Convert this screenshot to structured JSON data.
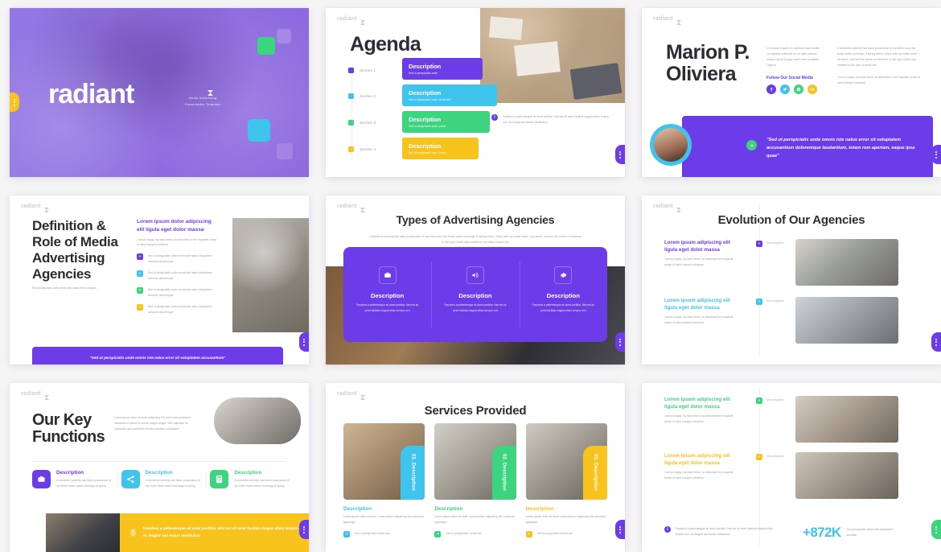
{
  "palette": {
    "purple": "#6c3ce9",
    "cyan": "#3fc4ee",
    "green": "#3dd47f",
    "yellow": "#f7c31c",
    "dark": "#2c2c34",
    "muted": "#9a9aa8",
    "page_bg": "#f5f5f6"
  },
  "brand": {
    "logo_text": "radiant",
    "logo_icon": "radiant-mark-icon"
  },
  "slides": [
    {
      "id": "cover",
      "title": "radiant",
      "subtitle_line1": "Media Advertising",
      "subtitle_line2": "Presentation Template",
      "tab_side": "left",
      "tab_color": "#f7c31c",
      "decor": [
        "green-square",
        "cyan-square",
        "ghost-square"
      ]
    },
    {
      "id": "agenda",
      "title": "Agenda",
      "sections": [
        {
          "label": "Section 1",
          "card_title": "Description",
          "card_sub": "Sed ut perspiciatis unde",
          "color": "#6c3ce9"
        },
        {
          "label": "Section 2",
          "card_title": "Description",
          "card_sub": "Sed ut perspiciatis unde omnis iste",
          "color": "#3fc4ee"
        },
        {
          "label": "Section 3",
          "card_title": "Description",
          "card_sub": "Sed ut perspiciatis unde omnis",
          "color": "#3dd47f"
        },
        {
          "label": "Section 4",
          "card_title": "Description",
          "card_sub": "Sed ut perspiciatis unde omnis",
          "color": "#f7c31c"
        }
      ],
      "note": "Faucibus a pellentesque sit amet porttitor. Nisi est sit amet facilisis magna etiam tempor orci. Ac feugiat sed lectus vestibulum",
      "note_icon": "info-icon",
      "image": "team-meeting-overhead-photo",
      "tab_color": "#6c3ce9"
    },
    {
      "id": "profile",
      "title_line1": "Marion P.",
      "title_line2": "Oliviera",
      "col1": "Li Europan lingues es membres sam familie. Lor separat existentie es un myth scientie, musica, sport Europa usar li sam vocabular. Lingues",
      "follow_label": "Follow Our Social Media",
      "socials": [
        {
          "name": "facebook-icon",
          "color": "#6c3ce9"
        },
        {
          "name": "twitter-icon",
          "color": "#3fc4ee"
        },
        {
          "name": "whatsapp-icon",
          "color": "#3dd47f"
        },
        {
          "name": "linkedin-icon",
          "color": "#f7c31c"
        }
      ],
      "col2_p1": "A wonderful serenity has taken possession of my entire soul, like these sweet mornings of spring which I enjoy with my whole heart. I am alone, and feel the charm of existence in this spot, which was created for the bliss of souls like",
      "col2_p2": "I am so happy, my dear friend, so absorbed in the exquisite sense of mere tranquil existence",
      "quote": "\"Sed ut perspiciatis unde omnis iste natus error sit voluptatem accusantium doloremque laudantium, totam rem aperiam, eaque ipsa quae\"",
      "quote_icon": "quote-badge-icon",
      "avatar": "woman-portrait-avatar",
      "tab_color": "#6c3ce9"
    },
    {
      "id": "definition",
      "title": "Definition & Role of Media Advertising Agencies",
      "subtitle": "Sed perspiciatis unde omnis iste natus error voluptas",
      "mid_heading": "Lorem ipsum dolor adipiscing elit ligula eget dolor massa",
      "mid_lead": "I am so happy, my dear friend, so absorbed in the exquisite sense of mere tranquil existence",
      "bullets": [
        {
          "text": "Sed ut perspiciatis unde omnis iste natus voluptatem accusan doloremque",
          "color": "#6c3ce9",
          "icon": "plus-square-icon"
        },
        {
          "text": "Sed ut perspiciatis unde omnis iste natus voluptatem accusan doloremque",
          "color": "#3fc4ee",
          "icon": "plus-square-icon"
        },
        {
          "text": "Sed ut perspiciatis unde omnis iste natus voluptatem accusan doloremque",
          "color": "#3dd47f",
          "icon": "plus-square-icon"
        },
        {
          "text": "Sed ut perspiciatis unde omnis iste natus voluptatem accusan doloremque",
          "color": "#f7c31c",
          "icon": "plus-square-icon"
        }
      ],
      "banner_quote": "\"Sed ut perspiciatis unde omnis iste natus error sit voluptatem accusantium\"",
      "image": "meeting-table-overhead-photo",
      "tab_color": "#6c3ce9"
    },
    {
      "id": "types",
      "title": "Types of Advertising Agencies",
      "lead": "A wonderful serenity has taken possession of my entire soul, like these sweet mornings of spring which I enjoy with my whole heart, I am alone, and feel the charm of existence in this spot, which was created for the bliss of souls like",
      "cards": [
        {
          "icon": "briefcase-icon",
          "title": "Description",
          "text": "Faucibus a pellentesque sit amet porttitor. Nisi est sit amet facilisis magna etiam tempor orci"
        },
        {
          "icon": "megaphone-icon",
          "title": "Description",
          "text": "Faucibus a pellentesque sit amet porttitor. Nisi est sit amet facilisis magna etiam tempor orci"
        },
        {
          "icon": "gears-icon",
          "title": "Description",
          "text": "Faucibus a pellentesque sit amet porttitor. Nisi est sit amet facilisis magna etiam tempor orci"
        }
      ],
      "panel_color": "#6c3ce9",
      "background_image": "desk-with-laptop-photo",
      "tab_color": "#6c3ce9"
    },
    {
      "id": "evolution",
      "title": "Evolution of Our Agencies",
      "rows": [
        {
          "heading": "Lorem ipsum adipiscing elit ligula eget dolor massa",
          "body": "I am so happy, my dear friend, so absorbed the exquisite sense of mere tranquil existence",
          "chip_label": "Description",
          "color": "#6c3ce9",
          "image": "office-team-discussion-photo"
        },
        {
          "heading": "Lorem ipsum adipiscing elit ligula eget dolor massa",
          "body": "I am so happy, my dear friend, so absorbed the exquisite sense of mere tranquil existence",
          "chip_label": "Description",
          "color": "#3fc4ee",
          "image": "whiteboard-presentation-photo"
        }
      ],
      "tab_color": "#6c3ce9"
    },
    {
      "id": "key-functions",
      "title_line1": "Our Key",
      "title_line2": "Functions",
      "lead": "Lorem ipsum dolor sit amet adipiscing elit, sed eiusmod tempor incididunt ut labore et dolore magna aliqua. Sed vulputate mi commodo quis parturient montes nascetur consequat",
      "items": [
        {
          "icon": "briefcase-icon",
          "title": "Description",
          "text": "A wonderful serenity has taken possession of my entire these sweet mornings of spring",
          "color": "#6c3ce9"
        },
        {
          "icon": "share-nodes-icon",
          "title": "Description",
          "text": "A wonderful serenity has taken possession of my entire these sweet mornings of spring",
          "color": "#3fc4ee"
        },
        {
          "icon": "calculator-icon",
          "title": "Description",
          "text": "A wonderful serenity has taken possession of my entire these sweet mornings of spring",
          "color": "#3dd47f"
        }
      ],
      "banner_text": "Faucibus a pellentesque sit amet porttitor. Nisi est sit amet facilisis magna etiam tempor orci. Ac feugiat sed lectus vestibulum",
      "banner_icon": "info-icon",
      "banner_color": "#f7c31c",
      "image": "overhead-desk-photo",
      "tab_color": "#6c3ce9"
    },
    {
      "id": "services",
      "title": "Services Provided",
      "cards": [
        {
          "tab_label": "01. Description",
          "color": "#3fc4ee",
          "title": "Description",
          "text": "Lorem ipsum dolor sit amet, consectetuer adipiscing elit commodo ligulaeget.",
          "foot": "Sed ut perspiciatis omnis iste",
          "image": "newspaper-reading-photo"
        },
        {
          "tab_label": "02. Description",
          "color": "#3dd47f",
          "title": "Description",
          "text": "Lorem ipsum dolor sit amet, consectetuer adipiscing elit commodo ligulaeget.",
          "foot": "Sed ut perspiciatis omnis iste",
          "image": "team-brainstorm-photo"
        },
        {
          "tab_label": "03. Description",
          "color": "#f7c31c",
          "title": "Description",
          "text": "Lorem ipsum dolor sit amet, consectetuer adipiscing elit commodo ligulaeget.",
          "foot": "Sed ut perspiciatis omnis iste",
          "image": "laptop-collaboration-photo"
        }
      ],
      "tab_color": "#6c3ce9"
    },
    {
      "id": "evolution-stats",
      "rows": [
        {
          "heading": "Lorem ipsum adipiscing elit ligula eget dolor massa",
          "body": "I am so happy, my dear friend, so absorbed the exquisite sense of mere tranquil existence",
          "chip_label": "Description",
          "color": "#3dd47f",
          "image": "office-conversation-photo"
        },
        {
          "heading": "Lorem ipsum adipiscing elit ligula eget dolor massa",
          "body": "I am so happy, my dear friend, so absorbed the exquisite sense of mere tranquil existence",
          "chip_label": "Description",
          "color": "#f7c31c",
          "image": "laptop-charts-photo"
        }
      ],
      "foot_note": "Faucibus a pellentesque sit amet porttitor. Nisi est sit amet facilisis magna etiam tempor orci. Ac feugiat sed lectus vestibulum",
      "foot_icon": "info-icon",
      "stat_number": "+872K",
      "stat_label": "Sed perspiciatis omnis iste voluptatem accusan",
      "tab_color": "#3dd47f"
    }
  ]
}
